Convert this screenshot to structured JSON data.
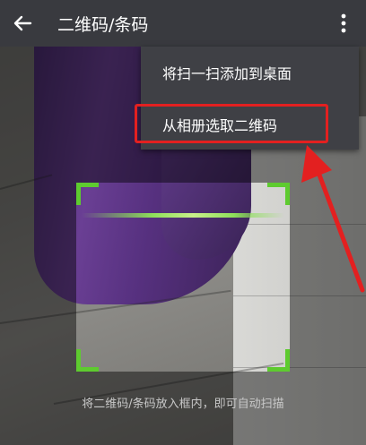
{
  "header": {
    "title": "二维码/条码",
    "back_icon": "arrow-left-icon",
    "more_icon": "more-vertical-icon"
  },
  "menu": {
    "items": [
      {
        "label": "将扫一扫添加到桌面"
      },
      {
        "label": "从相册选取二维码"
      }
    ]
  },
  "scanner": {
    "hint": "将二维码/条码放入框内，即可自动扫描",
    "accent_color": "#5ecb2f"
  },
  "annotation": {
    "highlight_color": "#e32020"
  }
}
